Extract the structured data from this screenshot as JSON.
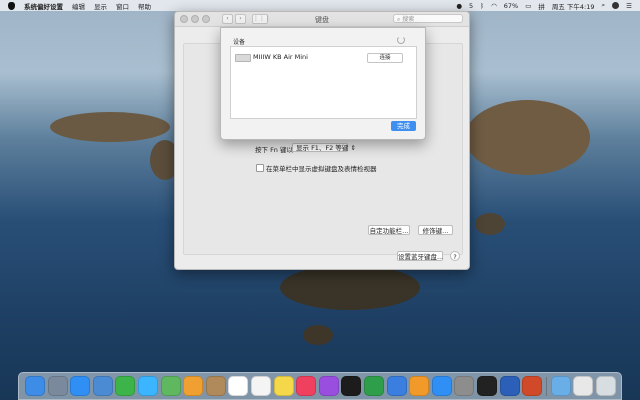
{
  "menubar": {
    "app_name": "系统偏好设置",
    "menus": [
      "编辑",
      "显示",
      "窗口",
      "帮助"
    ],
    "status_count": "5",
    "battery": "67%",
    "clock": "周五 下午4:19"
  },
  "window": {
    "title": "键盘",
    "search_placeholder": "搜索",
    "nav_back": "‹",
    "nav_forward": "›",
    "fn_label": "按下 Fn 键以",
    "fn_value": "显示 F1、F2 等键",
    "menubar_checkbox_label": "在菜单栏中显示虚拟键盘及表情检视器",
    "customize_button": "自定功能栏...",
    "modifier_button": "修饰键...",
    "bluetooth_button": "设置蓝牙键盘...",
    "help_label": "?"
  },
  "sheet": {
    "devices_label": "设备",
    "device_name": "MIIIW KB Air Mini",
    "connect_label": "连接",
    "done_label": "完成"
  },
  "dock": {
    "apps": [
      {
        "icon": "finder-icon",
        "color": "#3d8ce8"
      },
      {
        "icon": "launchpad-icon",
        "color": "#7a8a9c"
      },
      {
        "icon": "safari-icon",
        "color": "#2f8ff5"
      },
      {
        "icon": "preview-icon",
        "color": "#4a8bd4"
      },
      {
        "icon": "facetime-icon",
        "color": "#3cb44a"
      },
      {
        "icon": "messages-icon",
        "color": "#3bb5ff"
      },
      {
        "icon": "maps-icon",
        "color": "#5fb85f"
      },
      {
        "icon": "photos-icon",
        "color": "#f0a030"
      },
      {
        "icon": "contacts-icon",
        "color": "#b08a5a"
      },
      {
        "icon": "calendar-icon",
        "color": "#ffffff"
      },
      {
        "icon": "reminders-icon",
        "color": "#f4f4f4"
      },
      {
        "icon": "notes-icon",
        "color": "#f5d84a"
      },
      {
        "icon": "music-icon",
        "color": "#f04060"
      },
      {
        "icon": "podcasts-icon",
        "color": "#9a4ee0"
      },
      {
        "icon": "tv-icon",
        "color": "#1c1c1c"
      },
      {
        "icon": "numbers-icon",
        "color": "#2f9e4a"
      },
      {
        "icon": "keynote-icon",
        "color": "#3a7ee0"
      },
      {
        "icon": "pages-icon",
        "color": "#f19a2a"
      },
      {
        "icon": "appstore-icon",
        "color": "#2f8ff5"
      },
      {
        "icon": "system-preferences-icon",
        "color": "#8d8d8d"
      },
      {
        "icon": "qq-icon",
        "color": "#222222"
      },
      {
        "icon": "word-icon",
        "color": "#2b5fb8"
      },
      {
        "icon": "powerpoint-icon",
        "color": "#d04a2a"
      },
      {
        "icon": "downloads-folder-icon",
        "color": "#6aaee8"
      },
      {
        "icon": "document-icon",
        "color": "#e8e8e8"
      },
      {
        "icon": "trash-icon",
        "color": "#d8dde2"
      }
    ]
  }
}
